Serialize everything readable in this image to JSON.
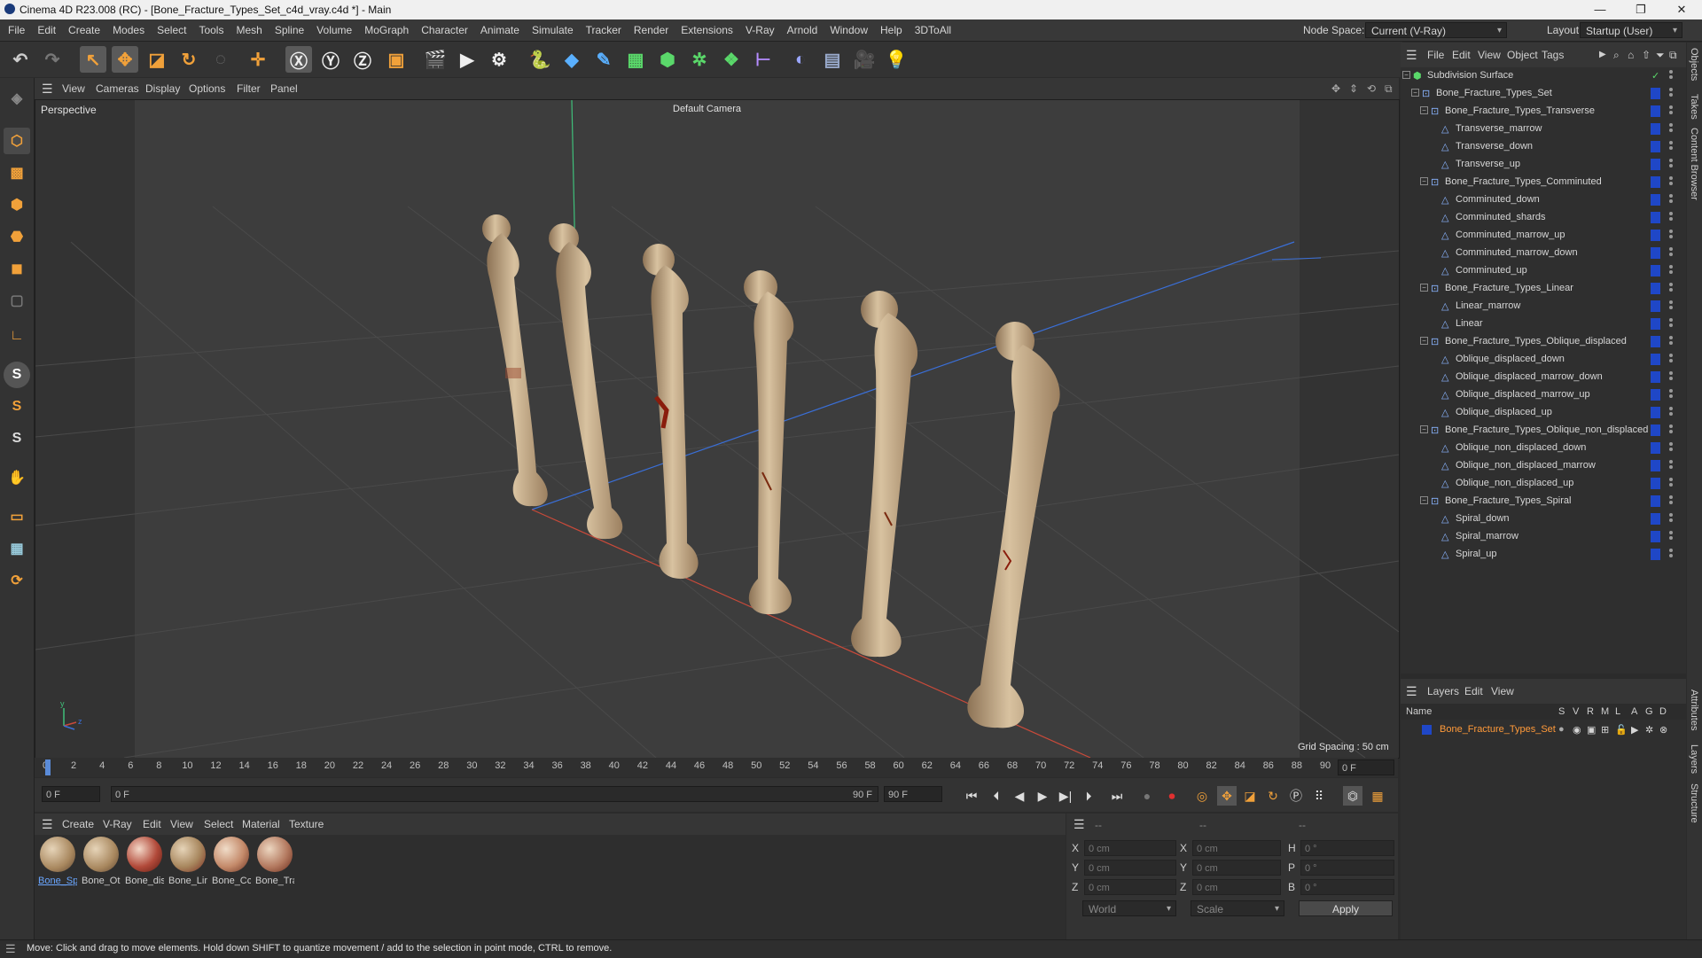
{
  "window": {
    "title": "Cinema 4D R23.008 (RC) - [Bone_Fracture_Types_Set_c4d_vray.c4d *] - Main",
    "minimize": "—",
    "maximize": "❐",
    "close": "✕"
  },
  "menubar": {
    "items": [
      "File",
      "Edit",
      "Create",
      "Modes",
      "Select",
      "Tools",
      "Mesh",
      "Spline",
      "Volume",
      "MoGraph",
      "Character",
      "Animate",
      "Simulate",
      "Tracker",
      "Render",
      "Extensions",
      "V-Ray",
      "Arnold",
      "Window",
      "Help",
      "3DToAll"
    ],
    "node_space_label": "Node Space:",
    "node_space_value": "Current (V-Ray)",
    "layout_label": "Layout:",
    "layout_value": "Startup (User)"
  },
  "viewport": {
    "menu": [
      "View",
      "Cameras",
      "Display",
      "Options",
      "Filter",
      "Panel"
    ],
    "view_name": "Perspective",
    "camera": "Default Camera",
    "grid_spacing": "Grid Spacing : 50 cm"
  },
  "timeline": {
    "ticks": [
      "0",
      "2",
      "4",
      "6",
      "8",
      "10",
      "12",
      "14",
      "16",
      "18",
      "20",
      "22",
      "24",
      "26",
      "28",
      "30",
      "32",
      "34",
      "36",
      "38",
      "40",
      "42",
      "44",
      "46",
      "48",
      "50",
      "52",
      "54",
      "56",
      "58",
      "60",
      "62",
      "64",
      "66",
      "68",
      "70",
      "72",
      "74",
      "76",
      "78",
      "80",
      "82",
      "84",
      "86",
      "88",
      "90"
    ],
    "current_frame_right": "0 F",
    "start_field": "0 F",
    "range_start": "0 F",
    "range_end": "90 F",
    "end_field": "90 F"
  },
  "materials": {
    "menu": [
      "Create",
      "V-Ray",
      "Edit",
      "View",
      "Select",
      "Material",
      "Texture"
    ],
    "items": [
      "Bone_Sp",
      "Bone_Ot",
      "Bone_dis",
      "Bone_Lir",
      "Bone_Cc",
      "Bone_Tra"
    ]
  },
  "coordinates": {
    "header_left": "--",
    "header_mid": "--",
    "header_right": "--",
    "pos": [
      {
        "axis": "X",
        "value": "0 cm"
      },
      {
        "axis": "Y",
        "value": "0 cm"
      },
      {
        "axis": "Z",
        "value": "0 cm"
      }
    ],
    "size": [
      {
        "axis": "X",
        "value": "0 cm"
      },
      {
        "axis": "Y",
        "value": "0 cm"
      },
      {
        "axis": "Z",
        "value": "0 cm"
      }
    ],
    "rot": [
      {
        "axis": "H",
        "value": "0 °"
      },
      {
        "axis": "P",
        "value": "0 °"
      },
      {
        "axis": "B",
        "value": "0 °"
      }
    ],
    "mode_world": "World",
    "mode_scale": "Scale",
    "apply": "Apply"
  },
  "object_manager": {
    "menu": [
      "File",
      "Edit",
      "View",
      "Object",
      "Tags"
    ],
    "objects": [
      {
        "name": "Subdivision Surface",
        "level": 0,
        "kind": "subdiv",
        "layer": false
      },
      {
        "name": "Bone_Fracture_Types_Set",
        "level": 1,
        "kind": "null",
        "layer": true
      },
      {
        "name": "Bone_Fracture_Types_Transverse",
        "level": 2,
        "kind": "null",
        "layer": true
      },
      {
        "name": "Transverse_marrow",
        "level": 3,
        "kind": "mesh",
        "layer": true
      },
      {
        "name": "Transverse_down",
        "level": 3,
        "kind": "mesh",
        "layer": true
      },
      {
        "name": "Transverse_up",
        "level": 3,
        "kind": "mesh",
        "layer": true
      },
      {
        "name": "Bone_Fracture_Types_Comminuted",
        "level": 2,
        "kind": "null",
        "layer": true
      },
      {
        "name": "Comminuted_down",
        "level": 3,
        "kind": "mesh",
        "layer": true
      },
      {
        "name": "Comminuted_shards",
        "level": 3,
        "kind": "mesh",
        "layer": true
      },
      {
        "name": "Comminuted_marrow_up",
        "level": 3,
        "kind": "mesh",
        "layer": true
      },
      {
        "name": "Comminuted_marrow_down",
        "level": 3,
        "kind": "mesh",
        "layer": true
      },
      {
        "name": "Comminuted_up",
        "level": 3,
        "kind": "mesh",
        "layer": true
      },
      {
        "name": "Bone_Fracture_Types_Linear",
        "level": 2,
        "kind": "null",
        "layer": true
      },
      {
        "name": "Linear_marrow",
        "level": 3,
        "kind": "mesh",
        "layer": true
      },
      {
        "name": "Linear",
        "level": 3,
        "kind": "mesh",
        "layer": true
      },
      {
        "name": "Bone_Fracture_Types_Oblique_displaced",
        "level": 2,
        "kind": "null",
        "layer": true
      },
      {
        "name": "Oblique_displaced_down",
        "level": 3,
        "kind": "mesh",
        "layer": true
      },
      {
        "name": "Oblique_displaced_marrow_down",
        "level": 3,
        "kind": "mesh",
        "layer": true
      },
      {
        "name": "Oblique_displaced_marrow_up",
        "level": 3,
        "kind": "mesh",
        "layer": true
      },
      {
        "name": "Oblique_displaced_up",
        "level": 3,
        "kind": "mesh",
        "layer": true
      },
      {
        "name": "Bone_Fracture_Types_Oblique_non_displaced",
        "level": 2,
        "kind": "null",
        "layer": true
      },
      {
        "name": "Oblique_non_displaced_down",
        "level": 3,
        "kind": "mesh",
        "layer": true
      },
      {
        "name": "Oblique_non_displaced_marrow",
        "level": 3,
        "kind": "mesh",
        "layer": true
      },
      {
        "name": "Oblique_non_displaced_up",
        "level": 3,
        "kind": "mesh",
        "layer": true
      },
      {
        "name": "Bone_Fracture_Types_Spiral",
        "level": 2,
        "kind": "null",
        "layer": true
      },
      {
        "name": "Spiral_down",
        "level": 3,
        "kind": "mesh",
        "layer": true
      },
      {
        "name": "Spiral_marrow",
        "level": 3,
        "kind": "mesh",
        "layer": true
      },
      {
        "name": "Spiral_up",
        "level": 3,
        "kind": "mesh",
        "layer": true
      }
    ]
  },
  "layers": {
    "menu": [
      "Layers",
      "Edit",
      "View"
    ],
    "columns": [
      "Name",
      "S",
      "V",
      "R",
      "M",
      "L",
      "A",
      "G",
      "D"
    ],
    "items": [
      "Bone_Fracture_Types_Set"
    ]
  },
  "side_tabs": [
    "Objects",
    "Takes",
    "Content Browser",
    "Attributes",
    "Layers",
    "Structure"
  ],
  "status": "Move: Click and drag to move elements. Hold down SHIFT to quantize movement / add to the selection in point mode, CTRL to remove.",
  "colors": {
    "accent": "#1f47c7",
    "layer_name": "#ff9a3a",
    "x_axis": "#c0392b",
    "y_axis": "#2ecc71",
    "z_axis": "#2f6fd6"
  }
}
